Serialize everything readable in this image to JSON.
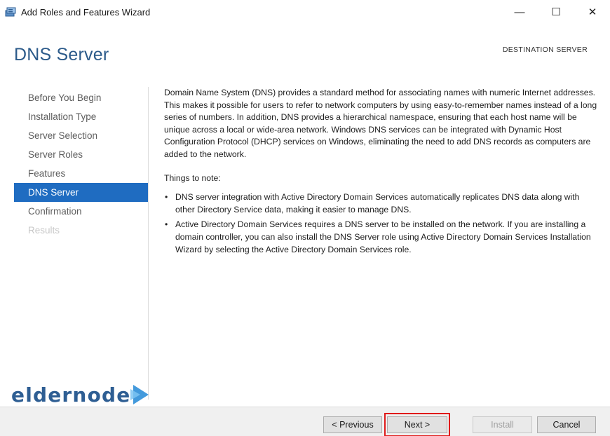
{
  "window": {
    "title": "Add Roles and Features Wizard",
    "minimize_glyph": "—",
    "maximize_glyph": "☐",
    "close_glyph": "✕"
  },
  "page": {
    "title": "DNS Server",
    "destination_label": "DESTINATION SERVER"
  },
  "nav": {
    "items": [
      {
        "label": "Before You Begin",
        "state": "normal"
      },
      {
        "label": "Installation Type",
        "state": "normal"
      },
      {
        "label": "Server Selection",
        "state": "normal"
      },
      {
        "label": "Server Roles",
        "state": "normal"
      },
      {
        "label": "Features",
        "state": "normal"
      },
      {
        "label": "DNS Server",
        "state": "active"
      },
      {
        "label": "Confirmation",
        "state": "normal"
      },
      {
        "label": "Results",
        "state": "disabled"
      }
    ]
  },
  "content": {
    "intro": "Domain Name System (DNS) provides a standard method for associating names with numeric Internet addresses. This makes it possible for users to refer to network computers by using easy-to-remember names instead of a long series of numbers. In addition, DNS provides a hierarchical namespace, ensuring that each host name will be unique across a local or wide-area network. Windows DNS services can be integrated with Dynamic Host Configuration Protocol (DHCP) services on Windows, eliminating the need to add DNS records as computers are added to the network.",
    "notes_heading": "Things to note:",
    "bullet_glyph": "•",
    "bullets": [
      "DNS server integration with Active Directory Domain Services automatically replicates DNS data along with other Directory Service data, making it easier to manage DNS.",
      "Active Directory Domain Services requires a DNS server to be installed on the network. If you are installing a domain controller, you can also install the DNS Server role using Active Directory Domain Services Installation Wizard by selecting the Active Directory Domain Services role."
    ]
  },
  "watermark": {
    "text": "eldernode"
  },
  "footer": {
    "previous_label": "< Previous",
    "next_label": "Next >",
    "install_label": "Install",
    "cancel_label": "Cancel",
    "install_enabled": false,
    "highlight_color": "#e01b1b"
  },
  "colors": {
    "accent": "#1f6cc1",
    "title": "#2b5a8a",
    "logo": "#2e5e93"
  },
  "icons": {
    "app": "server-manager-icon",
    "watermark": "play-arrow-logo-icon"
  }
}
